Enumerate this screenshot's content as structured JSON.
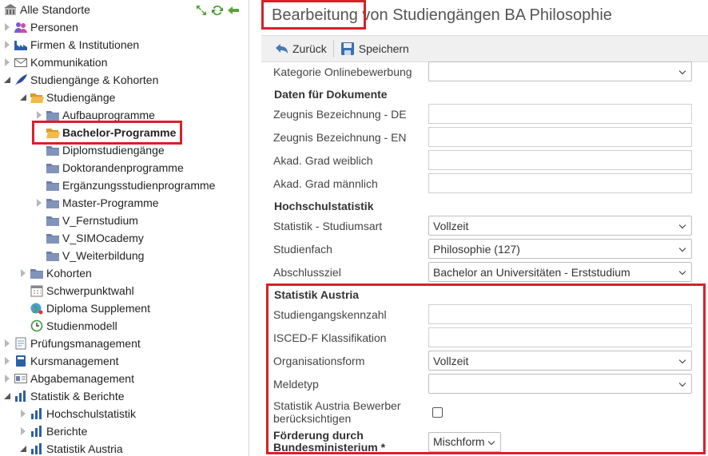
{
  "tree": {
    "nodes": [
      {
        "label": "Alle Standorte",
        "icon": "building-icon",
        "twisty": "none"
      },
      {
        "label": "Personen",
        "icon": "people-icon",
        "twisty": "collapsed"
      },
      {
        "label": "Firmen & Institutionen",
        "icon": "factory-icon",
        "twisty": "collapsed"
      },
      {
        "label": "Kommunikation",
        "icon": "envelope-icon",
        "twisty": "collapsed"
      },
      {
        "label": "Studiengänge & Kohorten",
        "icon": "quill-icon",
        "twisty": "open"
      },
      {
        "label": "Studiengänge",
        "icon": "folder-open-icon",
        "twisty": "open"
      },
      {
        "label": "Aufbauprogramme",
        "icon": "folder-icon",
        "twisty": "collapsed"
      },
      {
        "label": "Bachelor-Programme",
        "icon": "folder-open-icon",
        "twisty": "none",
        "selected": true
      },
      {
        "label": "Diplomstudiengänge",
        "icon": "folder-icon",
        "twisty": "none"
      },
      {
        "label": "Doktorandenprogramme",
        "icon": "folder-icon",
        "twisty": "none"
      },
      {
        "label": "Ergänzungsstudienprogramme",
        "icon": "folder-icon",
        "twisty": "none"
      },
      {
        "label": "Master-Programme",
        "icon": "folder-icon",
        "twisty": "collapsed"
      },
      {
        "label": "V_Fernstudium",
        "icon": "folder-icon",
        "twisty": "none"
      },
      {
        "label": "V_SIMOcademy",
        "icon": "folder-icon",
        "twisty": "none"
      },
      {
        "label": "V_Weiterbildung",
        "icon": "folder-icon",
        "twisty": "none"
      },
      {
        "label": "Kohorten",
        "icon": "folder-icon",
        "twisty": "collapsed"
      },
      {
        "label": "Schwerpunktwahl",
        "icon": "calendar-icon",
        "twisty": "none"
      },
      {
        "label": "Diploma Supplement",
        "icon": "globe-icon",
        "twisty": "none"
      },
      {
        "label": "Studienmodell",
        "icon": "clock-icon",
        "twisty": "none"
      },
      {
        "label": "Prüfungsmanagement",
        "icon": "exam-icon",
        "twisty": "collapsed"
      },
      {
        "label": "Kursmanagement",
        "icon": "book-icon",
        "twisty": "collapsed"
      },
      {
        "label": "Abgabemanagement",
        "icon": "card-icon",
        "twisty": "collapsed"
      },
      {
        "label": "Statistik & Berichte",
        "icon": "bar-chart-icon",
        "twisty": "open"
      },
      {
        "label": "Hochschulstatistik",
        "icon": "bar-chart-icon",
        "twisty": "collapsed"
      },
      {
        "label": "Berichte",
        "icon": "bar-chart-icon",
        "twisty": "collapsed"
      },
      {
        "label": "Statistik Austria",
        "icon": "bar-chart-icon",
        "twisty": "open"
      }
    ]
  },
  "page": {
    "title": "Bearbeitung von Studiengängen BA Philosophie"
  },
  "toolbar": {
    "back_label": "Zurück",
    "save_label": "Speichern"
  },
  "form": {
    "kategorie_label": "Kategorie Onlinebewerbung",
    "kategorie_value": "",
    "doc_section": "Daten für Dokumente",
    "zeugnis_de_label": "Zeugnis Bezeichnung - DE",
    "zeugnis_en_label": "Zeugnis Bezeichnung - EN",
    "grad_w_label": "Akad. Grad weiblich",
    "grad_m_label": "Akad. Grad männlich",
    "hs_section": "Hochschulstatistik",
    "studiumsart_label": "Statistik - Studiumsart",
    "studiumsart_value": "Vollzeit",
    "studienfach_label": "Studienfach",
    "studienfach_value": "Philosophie (127)",
    "abschluss_label": "Abschlussziel",
    "abschluss_value": "Bachelor an Universitäten - Erststudium",
    "austria_section": "Statistik Austria",
    "kennzahl_label": "Studiengangskennzahl",
    "isced_label": "ISCED-F Klassifikation",
    "orgform_label": "Organisationsform",
    "orgform_value": "Vollzeit",
    "meldetyp_label": "Meldetyp",
    "meldetyp_value": "",
    "bewerber_label_1": "Statistik Austria Bewerber",
    "bewerber_label_2": "berücksichtigen",
    "foerderung_label_1": "Förderung durch",
    "foerderung_label_2": "Bundesministerium *",
    "foerderung_value": "Mischform"
  }
}
